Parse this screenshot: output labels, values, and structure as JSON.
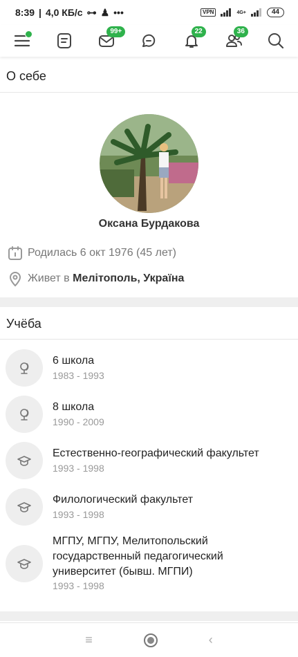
{
  "status_bar": {
    "time": "8:39",
    "speed": "4,0 КБ/с",
    "more": "•••",
    "vpn": "VPN",
    "net": "4G+",
    "battery": "44"
  },
  "toolbar": {
    "messages_badge": "99+",
    "notifications_badge": "22",
    "friends_badge": "36"
  },
  "about": {
    "title": "О себе",
    "name": "Оксана Бурдакова",
    "birth": "Родилась 6 окт 1976 (45 лет)",
    "lives_prefix": "Живет в ",
    "lives_city": "Мелітополь, Україна"
  },
  "education": {
    "title": "Учёба",
    "items": [
      {
        "name": "6 школа",
        "years": "1983 - 1993",
        "icon": "school-icon"
      },
      {
        "name": "8 школа",
        "years": "1990 - 2009",
        "icon": "school-icon"
      },
      {
        "name": "Естественно-географический факультет",
        "years": "1993 - 1998",
        "icon": "graduation-cap-icon"
      },
      {
        "name": "Филологический факультет",
        "years": "1993 - 1998",
        "icon": "graduation-cap-icon"
      },
      {
        "name": "МГПУ, МГПУ, Мелитопольский государственный педагогический университет (бывш. МГПИ)",
        "years": "1993 - 1998",
        "icon": "graduation-cap-icon"
      }
    ]
  },
  "colors": {
    "accent": "#2fb24c",
    "muted": "#999999"
  }
}
